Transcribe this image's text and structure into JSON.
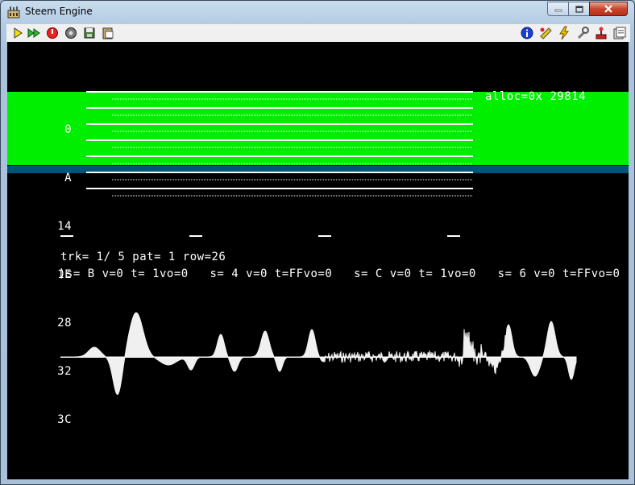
{
  "window": {
    "title": "Steem Engine"
  },
  "toolbar": {
    "left": [
      "play-icon",
      "fast-forward-icon",
      "reset-icon",
      "joystick-icon",
      "disk-manager-icon",
      "paste-icon"
    ],
    "right": [
      "info-icon",
      "patches-icon",
      "shortcuts-icon",
      "options-icon",
      "joystick-config-icon",
      "memory-snapshot-icon"
    ]
  },
  "tracker": {
    "row_labels": [
      "0",
      "A",
      "14",
      "1E",
      "28",
      "32",
      "3C"
    ],
    "alloc": "alloc=0x 29814",
    "status_line": "trk= 1/ 5 pat= 1 row=26",
    "channel_line": ")s= B v=0 t= 1vo=0   s= 4 v=0 t=FFvo=0   s= C v=0 t= 1vo=0   s= 6 v=0 t=FFvo=0"
  },
  "colors": {
    "highlight_band": "#00ee00",
    "play_row": "#005577",
    "background": "#000000",
    "foreground": "#ffffff"
  }
}
